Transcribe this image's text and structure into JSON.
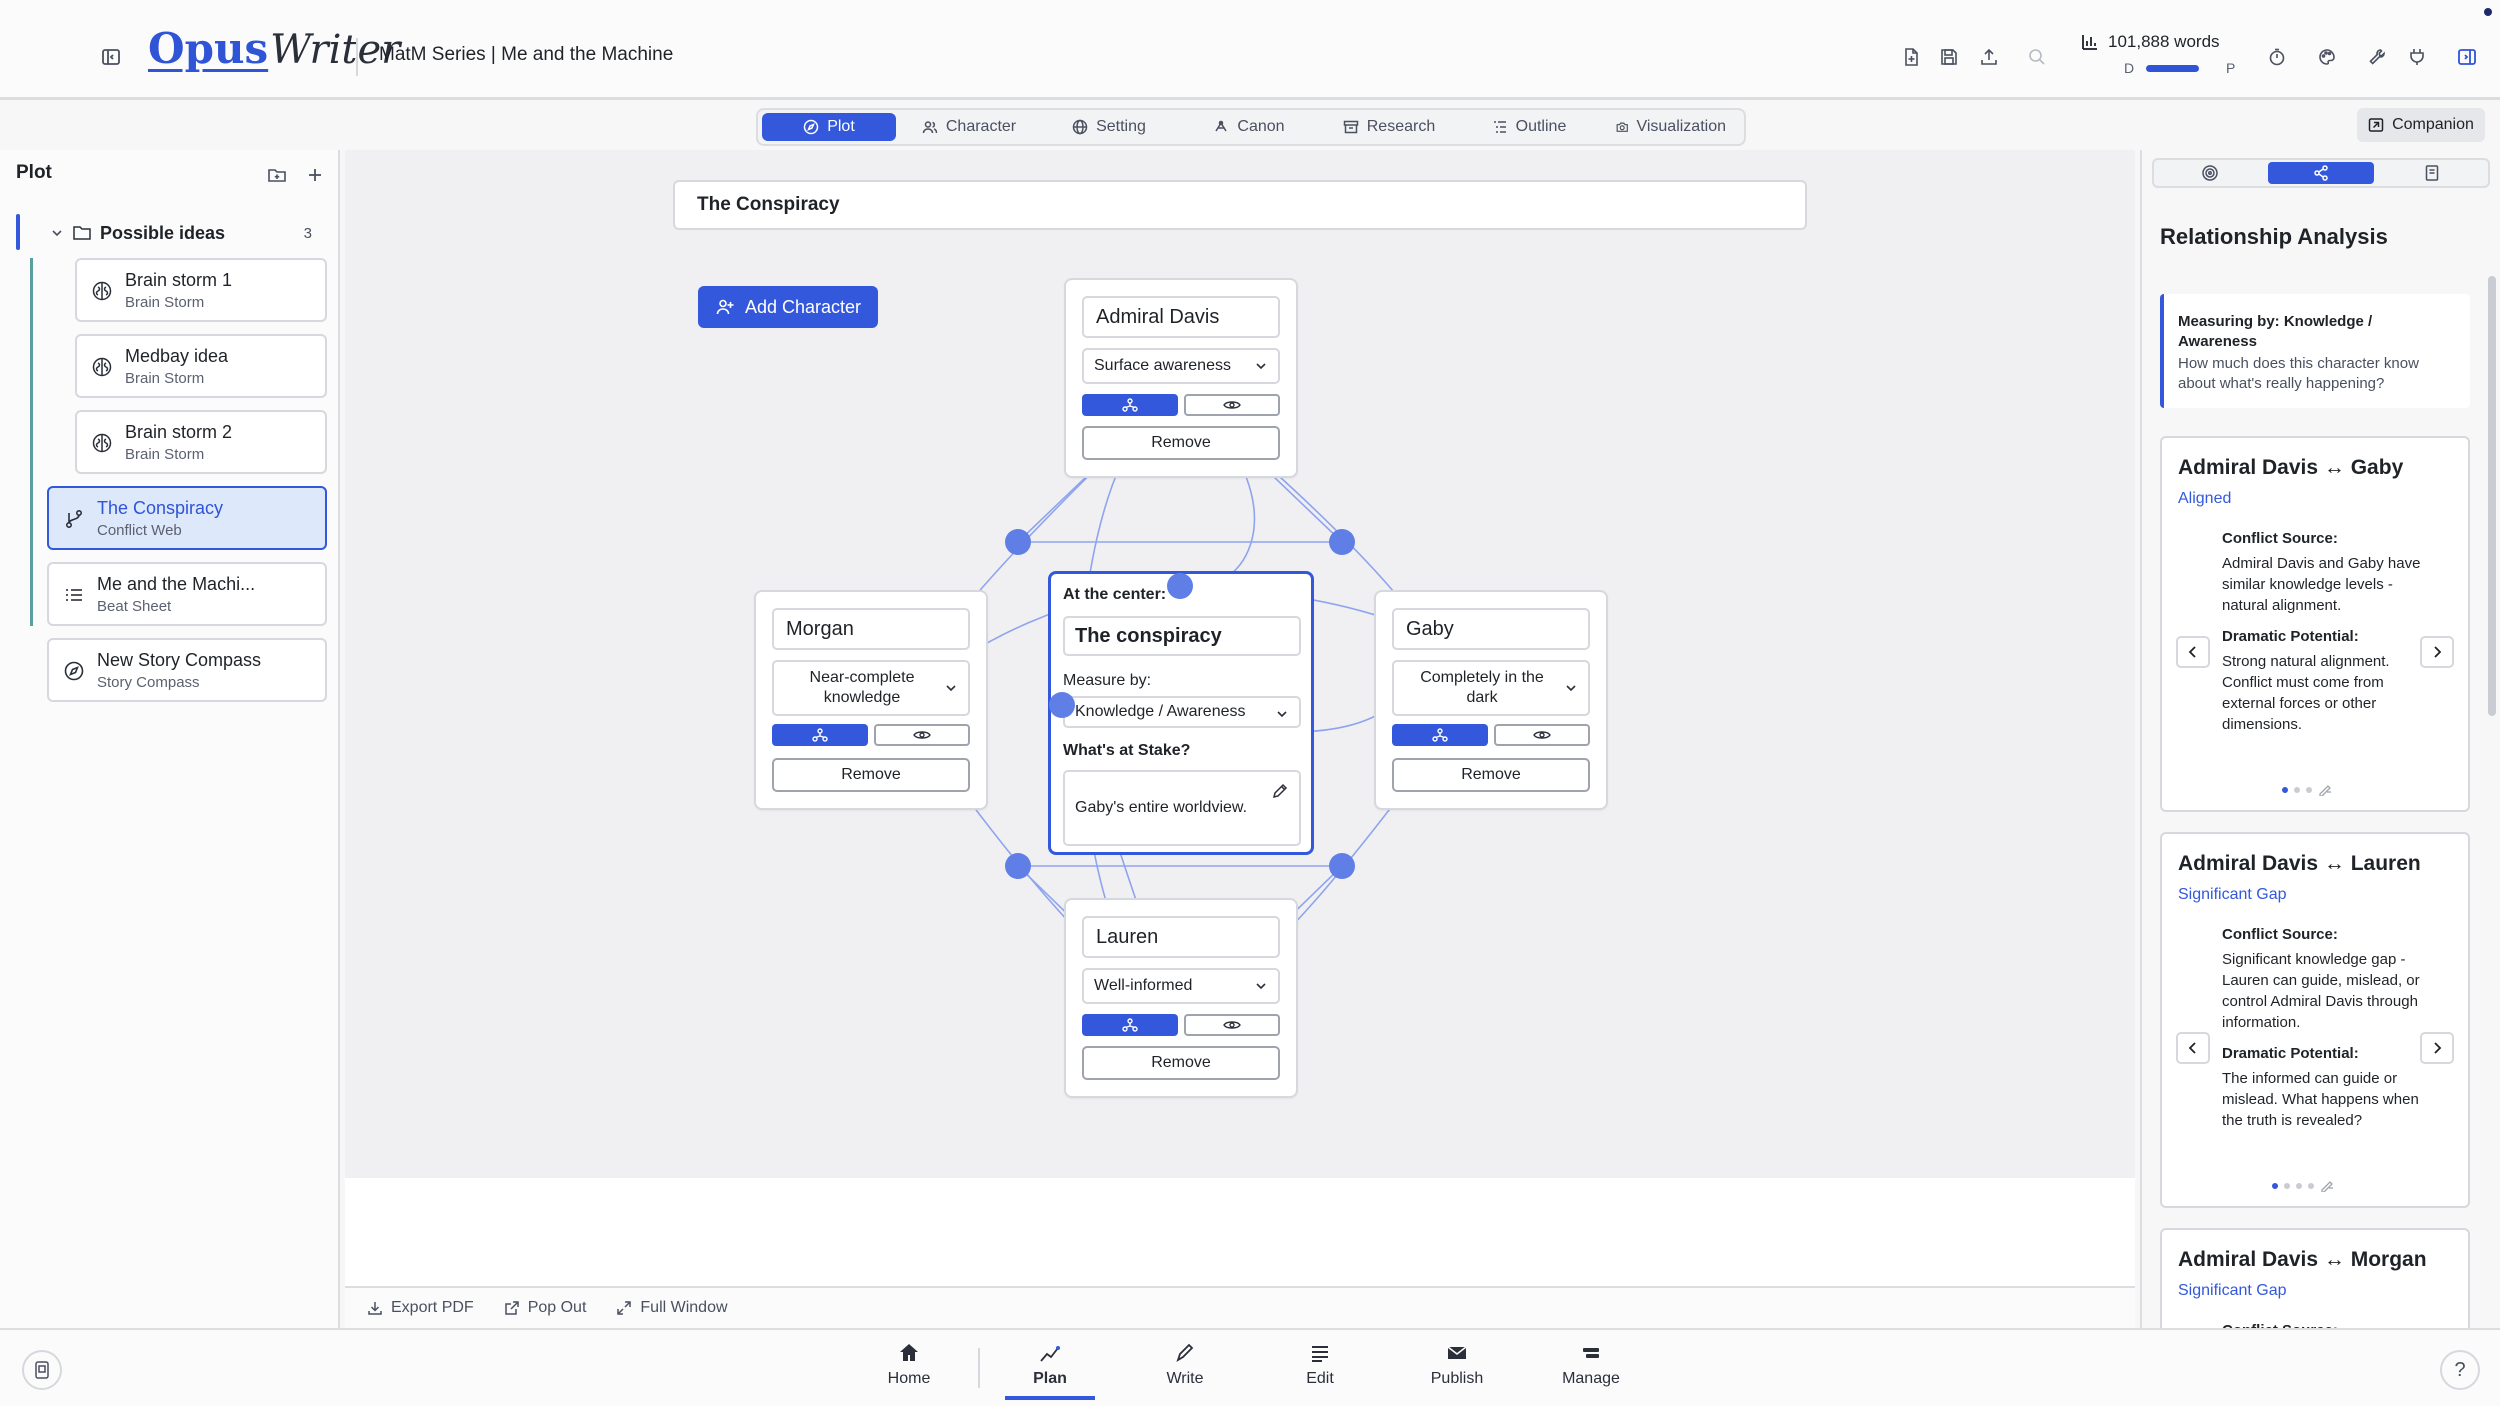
{
  "app": {
    "project_title": "MatM Series | Me and the Machine",
    "logo": {
      "part1": "Opus",
      "part2": "Writer"
    },
    "word_count": "101,888 words",
    "word_count_left": "D",
    "word_count_right": "P",
    "word_count_progress": 0.7,
    "colors": {
      "accent": "#3358dc",
      "accent_light": "#dde8fb",
      "node_dot": "#5f7ee6"
    }
  },
  "toolbar_icons": [
    "new-document-icon",
    "save-icon",
    "upload-icon",
    "search-icon",
    "timer-icon",
    "palette-icon",
    "tools-icon",
    "plugin-icon",
    "panel-toggle-icon"
  ],
  "tabs": [
    {
      "label": "Plot",
      "icon": "compass-icon",
      "active": true
    },
    {
      "label": "Character",
      "icon": "users-icon",
      "active": false
    },
    {
      "label": "Setting",
      "icon": "globe-icon",
      "active": false
    },
    {
      "label": "Canon",
      "icon": "canon-icon",
      "active": false
    },
    {
      "label": "Research",
      "icon": "archive-icon",
      "active": false
    },
    {
      "label": "Outline",
      "icon": "outline-icon",
      "active": false
    },
    {
      "label": "Visualization",
      "icon": "camera-icon",
      "active": false
    }
  ],
  "companion_label": "Companion",
  "sidebar": {
    "title": "Plot",
    "folder": {
      "name": "Possible ideas",
      "count": "3"
    },
    "folder_items": [
      {
        "title": "Brain storm 1",
        "subtitle": "Brain Storm",
        "icon": "brain-icon"
      },
      {
        "title": "Medbay idea",
        "subtitle": "Brain Storm",
        "icon": "brain-icon"
      },
      {
        "title": "Brain storm 2",
        "subtitle": "Brain Storm",
        "icon": "brain-icon"
      }
    ],
    "items": [
      {
        "title": "The Conspiracy",
        "subtitle": "Conflict Web",
        "icon": "branch-icon",
        "selected": true
      },
      {
        "title": "Me and the Machi...",
        "subtitle": "Beat Sheet",
        "icon": "list-icon",
        "selected": false
      },
      {
        "title": "New Story Compass",
        "subtitle": "Story Compass",
        "icon": "compass-icon",
        "selected": false
      }
    ]
  },
  "web": {
    "title": "The Conspiracy",
    "add_character_label": "Add Character",
    "remove_label": "Remove",
    "center": {
      "at_center_label": "At the center:",
      "name": "The conspiracy",
      "measure_label": "Measure by:",
      "measure_value": "Knowledge / Awareness",
      "stake_label": "What's at Stake?",
      "stake_value": "Gaby's entire worldview."
    },
    "characters": [
      {
        "name": "Admiral Davis",
        "level": "Surface awareness"
      },
      {
        "name": "Morgan",
        "level": "Near-complete knowledge"
      },
      {
        "name": "Gaby",
        "level": "Completely in the dark"
      },
      {
        "name": "Lauren",
        "level": "Well-informed"
      }
    ]
  },
  "canvas_footer": {
    "export_pdf": "Export PDF",
    "pop_out": "Pop Out",
    "full_window": "Full Window"
  },
  "analysis": {
    "title": "Relationship Analysis",
    "measure_title": "Measuring by: Knowledge / Awareness",
    "measure_desc": "How much does this character know about what's really happening?",
    "cards": [
      {
        "title": "Admiral Davis ↔ Gaby",
        "status": "Aligned",
        "conflict_label": "Conflict Source:",
        "conflict_text": "Admiral Davis and Gaby have similar knowledge levels - natural alignment.",
        "drama_label": "Dramatic Potential:",
        "drama_text": "Strong natural alignment. Conflict must come from external forces or other dimensions."
      },
      {
        "title": "Admiral Davis ↔ Lauren",
        "status": "Significant Gap",
        "conflict_label": "Conflict Source:",
        "conflict_text": "Significant knowledge gap - Lauren can guide, mislead, or control Admiral Davis through information.",
        "drama_label": "Dramatic Potential:",
        "drama_text": "The informed can guide or mislead. What happens when the truth is revealed?"
      },
      {
        "title": "Admiral Davis ↔ Morgan",
        "status": "Significant Gap",
        "conflict_label": "Conflict Source:"
      }
    ]
  },
  "bottom_nav": [
    {
      "label": "Home",
      "icon": "home-icon",
      "active": false
    },
    {
      "label": "Plan",
      "icon": "plan-icon",
      "active": true
    },
    {
      "label": "Write",
      "icon": "pen-icon",
      "active": false
    },
    {
      "label": "Edit",
      "icon": "edit-list-icon",
      "active": false
    },
    {
      "label": "Publish",
      "icon": "mail-icon",
      "active": false
    },
    {
      "label": "Manage",
      "icon": "manage-icon",
      "active": false
    }
  ]
}
